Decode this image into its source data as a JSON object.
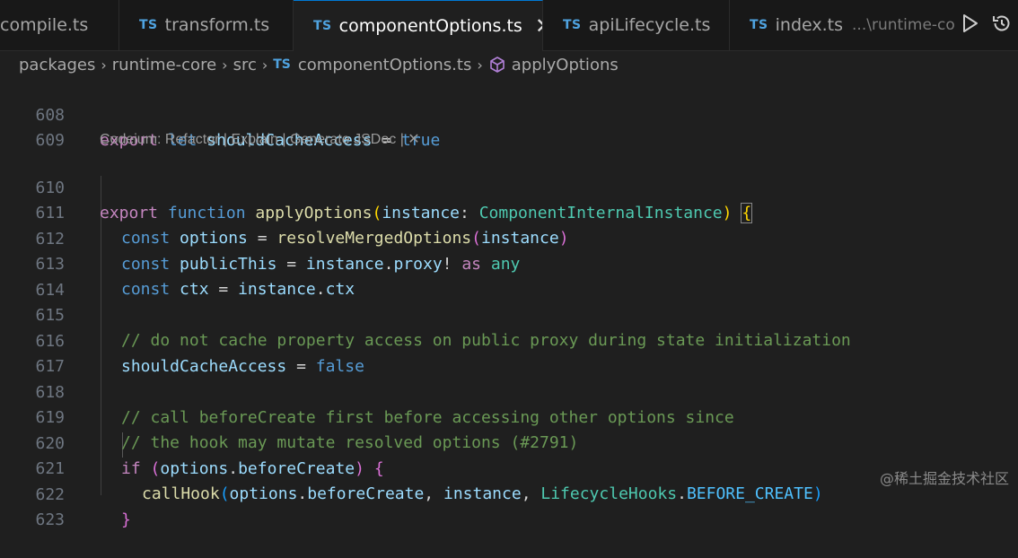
{
  "tabs": [
    {
      "badge": "TS",
      "label": "compile.ts",
      "active": false
    },
    {
      "badge": "TS",
      "label": "transform.ts",
      "active": false
    },
    {
      "badge": "TS",
      "label": "componentOptions.ts",
      "active": true
    },
    {
      "badge": "TS",
      "label": "apiLifecycle.ts",
      "active": false
    },
    {
      "badge": "TS",
      "label": "index.ts",
      "path": "...\\runtime-core",
      "active": false
    }
  ],
  "tab_actions": [
    "run-icon",
    "history-icon"
  ],
  "breadcrumb": {
    "items": [
      "packages",
      "runtime-core",
      "src"
    ],
    "file_badge": "TS",
    "file": "componentOptions.ts",
    "symbol": "applyOptions"
  },
  "codelens": "Codeium: Refactor | Explain | Generate JSDoc | ✕",
  "line_numbers": [
    "608",
    "609",
    "610",
    "611",
    "612",
    "613",
    "614",
    "615",
    "616",
    "617",
    "618",
    "619",
    "620",
    "621",
    "622",
    "623"
  ],
  "code": {
    "l608": [
      "export",
      " ",
      "let",
      " ",
      "shouldCacheAccess",
      " = ",
      "true"
    ],
    "l610": [
      "export",
      " ",
      "function",
      " ",
      "applyOptions",
      "(",
      "instance",
      ": ",
      "ComponentInternalInstance",
      ") ",
      "{"
    ],
    "l611": [
      "const",
      " ",
      "options",
      " = ",
      "resolveMergedOptions",
      "(",
      "instance",
      ")"
    ],
    "l612": [
      "const",
      " ",
      "publicThis",
      " = ",
      "instance",
      ".",
      "proxy",
      "! ",
      "as",
      " ",
      "any"
    ],
    "l613": [
      "const",
      " ",
      "ctx",
      " = ",
      "instance",
      ".",
      "ctx"
    ],
    "l615": "// do not cache property access on public proxy during state initialization",
    "l616": [
      "shouldCacheAccess",
      " = ",
      "false"
    ],
    "l618": "// call beforeCreate first before accessing other options since",
    "l619": "// the hook may mutate resolved options (#2791)",
    "l620": [
      "if",
      " (",
      "options",
      ".",
      "beforeCreate",
      ") ",
      "{"
    ],
    "l621": [
      "callHook",
      "(",
      "options",
      ".",
      "beforeCreate",
      ", ",
      "instance",
      ", ",
      "LifecycleHooks",
      ".",
      "BEFORE_CREATE",
      ")"
    ],
    "l622": "}"
  },
  "watermark": "@稀土掘金技术社区",
  "colors": {
    "accent": "#0078d4",
    "ts_badge": "#4fa3e0",
    "keyword": "#569cd6",
    "function": "#dcdcaa",
    "variable": "#9cdcfe",
    "type": "#4ec9b0",
    "comment": "#6a9955"
  }
}
